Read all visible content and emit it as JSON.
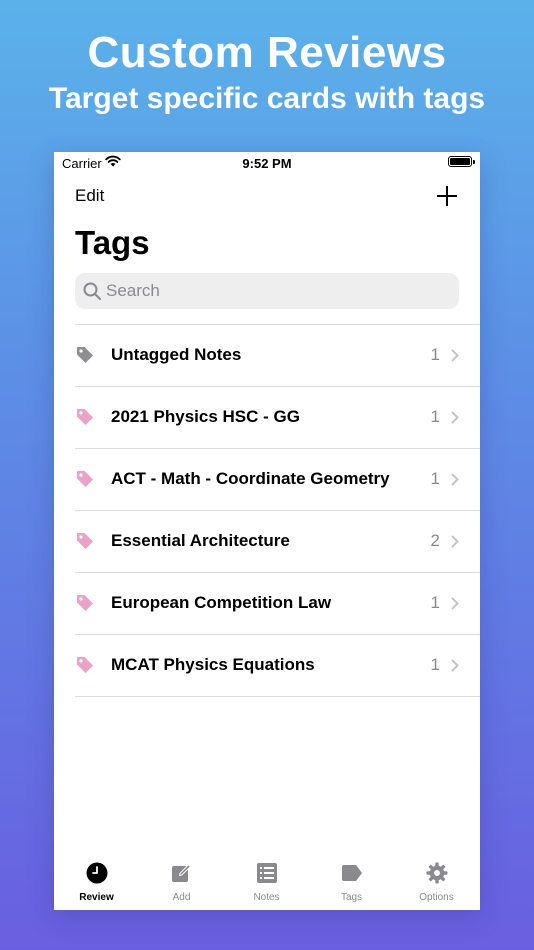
{
  "hero": {
    "title": "Custom Reviews",
    "subtitle": "Target specific cards with tags"
  },
  "status_bar": {
    "carrier": "Carrier",
    "time": "9:52 PM"
  },
  "nav": {
    "edit_label": "Edit",
    "add_icon": "plus-icon"
  },
  "page_title": "Tags",
  "search": {
    "placeholder": "Search",
    "value": ""
  },
  "tags": [
    {
      "label": "Untagged Notes",
      "count": "1",
      "icon": "tag-icon",
      "color": "#8e8e93"
    },
    {
      "label": "2021 Physics HSC - GG",
      "count": "1",
      "icon": "tag-icon",
      "color": "#e9a2c8"
    },
    {
      "label": "ACT - Math - Coordinate Geometry",
      "count": "1",
      "icon": "tag-icon",
      "color": "#e9a2c8"
    },
    {
      "label": "Essential Architecture",
      "count": "2",
      "icon": "tag-icon",
      "color": "#e9a2c8"
    },
    {
      "label": "European Competition Law",
      "count": "1",
      "icon": "tag-icon",
      "color": "#e9a2c8"
    },
    {
      "label": "MCAT Physics Equations",
      "count": "1",
      "icon": "tag-icon",
      "color": "#e9a2c8"
    }
  ],
  "tab_bar": {
    "tabs": [
      {
        "label": "Review",
        "icon": "clock-icon",
        "active": true
      },
      {
        "label": "Add",
        "icon": "compose-icon",
        "active": false
      },
      {
        "label": "Notes",
        "icon": "list-icon",
        "active": false
      },
      {
        "label": "Tags",
        "icon": "tag-icon",
        "active": false
      },
      {
        "label": "Options",
        "icon": "gear-icon",
        "active": false
      }
    ]
  },
  "colors": {
    "accent_tag": "#e9a2c8",
    "untagged_tag": "#8e8e93",
    "inactive_tab": "#8a8a8e",
    "background_top": "#5bb2ea",
    "background_bottom": "#6a5fe0"
  }
}
